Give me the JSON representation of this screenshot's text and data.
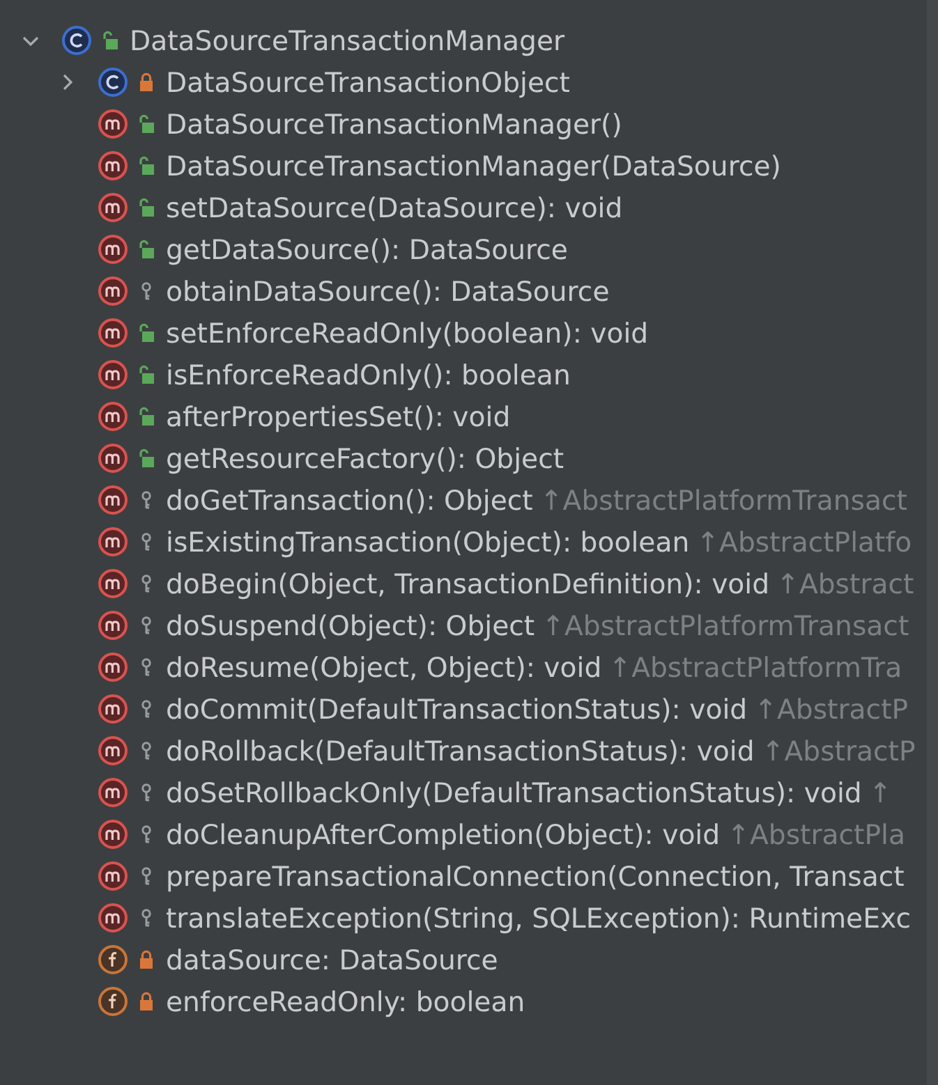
{
  "tree": [
    {
      "kind": "class",
      "access": {
        "kind": "public"
      },
      "name": "DataSourceTransactionManager",
      "expanded": true,
      "children": [
        {
          "kind": "class",
          "access": {
            "kind": "private"
          },
          "name": "DataSourceTransactionObject",
          "expanded": false
        },
        {
          "kind": "method",
          "access": {
            "kind": "public"
          },
          "name": "DataSourceTransactionManager()"
        },
        {
          "kind": "method",
          "access": {
            "kind": "public"
          },
          "name": "DataSourceTransactionManager(DataSource)"
        },
        {
          "kind": "method",
          "access": {
            "kind": "public"
          },
          "name": "setDataSource(DataSource): void"
        },
        {
          "kind": "method",
          "access": {
            "kind": "public"
          },
          "name": "getDataSource(): DataSource"
        },
        {
          "kind": "method",
          "access": {
            "kind": "protected"
          },
          "name": "obtainDataSource(): DataSource"
        },
        {
          "kind": "method",
          "access": {
            "kind": "public"
          },
          "name": "setEnforceReadOnly(boolean): void"
        },
        {
          "kind": "method",
          "access": {
            "kind": "public"
          },
          "name": "isEnforceReadOnly(): boolean"
        },
        {
          "kind": "method",
          "access": {
            "kind": "public"
          },
          "name": "afterPropertiesSet(): void"
        },
        {
          "kind": "method",
          "access": {
            "kind": "public"
          },
          "name": "getResourceFactory(): Object"
        },
        {
          "kind": "method",
          "access": {
            "kind": "protected"
          },
          "name": "doGetTransaction(): Object",
          "inherited": "↑AbstractPlatformTransact"
        },
        {
          "kind": "method",
          "access": {
            "kind": "protected"
          },
          "name": "isExistingTransaction(Object): boolean",
          "inherited": "↑AbstractPlatfo"
        },
        {
          "kind": "method",
          "access": {
            "kind": "protected"
          },
          "name": "doBegin(Object, TransactionDefinition): void",
          "inherited": "↑Abstract"
        },
        {
          "kind": "method",
          "access": {
            "kind": "protected"
          },
          "name": "doSuspend(Object): Object",
          "inherited": "↑AbstractPlatformTransact"
        },
        {
          "kind": "method",
          "access": {
            "kind": "protected"
          },
          "name": "doResume(Object, Object): void",
          "inherited": "↑AbstractPlatformTra"
        },
        {
          "kind": "method",
          "access": {
            "kind": "protected"
          },
          "name": "doCommit(DefaultTransactionStatus): void",
          "inherited": "↑AbstractP"
        },
        {
          "kind": "method",
          "access": {
            "kind": "protected"
          },
          "name": "doRollback(DefaultTransactionStatus): void",
          "inherited": "↑AbstractP"
        },
        {
          "kind": "method",
          "access": {
            "kind": "protected"
          },
          "name": "doSetRollbackOnly(DefaultTransactionStatus): void",
          "inherited": "↑"
        },
        {
          "kind": "method",
          "access": {
            "kind": "protected"
          },
          "name": "doCleanupAfterCompletion(Object): void",
          "inherited": "↑AbstractPla"
        },
        {
          "kind": "method",
          "access": {
            "kind": "protected"
          },
          "name": "prepareTransactionalConnection(Connection, Transact"
        },
        {
          "kind": "method",
          "access": {
            "kind": "protected"
          },
          "name": "translateException(String, SQLException): RuntimeExc"
        },
        {
          "kind": "field",
          "access": {
            "kind": "private"
          },
          "name": "dataSource: DataSource"
        },
        {
          "kind": "field",
          "access": {
            "kind": "private"
          },
          "name": "enforceReadOnly: boolean"
        }
      ]
    }
  ]
}
